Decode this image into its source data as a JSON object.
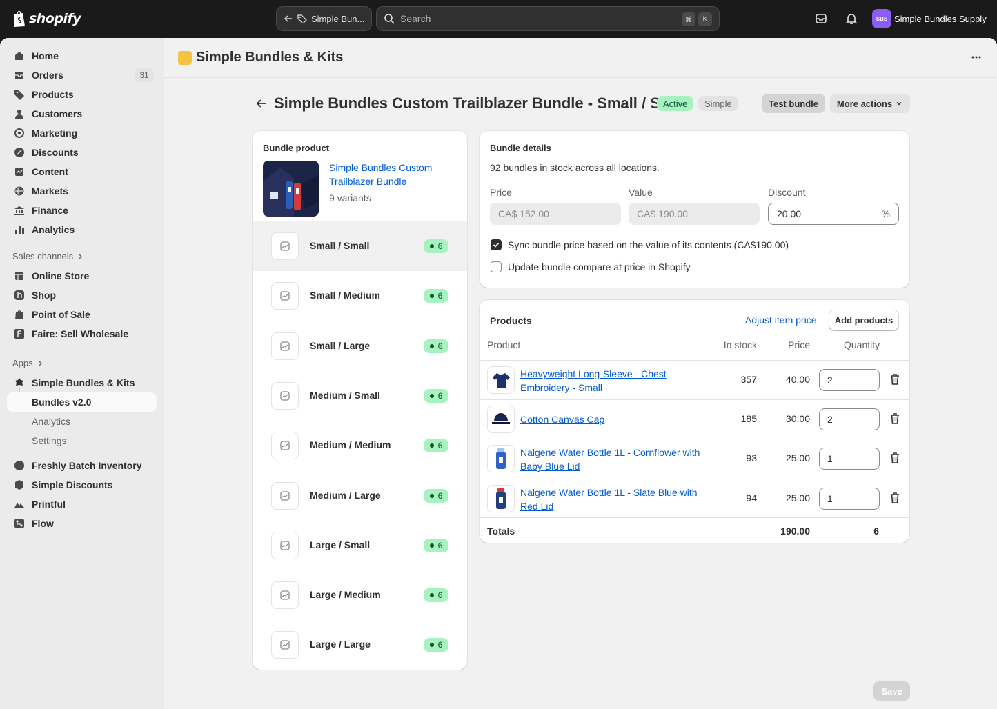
{
  "topbar": {
    "logo_text": "shopify",
    "back_label": "Simple Bun...",
    "search_placeholder": "Search",
    "kbd_cmd": "⌘",
    "kbd_k": "K",
    "store_initials": "SBS",
    "store_name": "Simple Bundles Supply"
  },
  "sidebar": {
    "items": [
      {
        "label": "Home",
        "icon": "home-icon"
      },
      {
        "label": "Orders",
        "icon": "orders-icon",
        "count": "31"
      },
      {
        "label": "Products",
        "icon": "tag-icon"
      },
      {
        "label": "Customers",
        "icon": "person-icon"
      },
      {
        "label": "Marketing",
        "icon": "target-icon"
      },
      {
        "label": "Discounts",
        "icon": "discount-icon"
      },
      {
        "label": "Content",
        "icon": "content-icon"
      },
      {
        "label": "Markets",
        "icon": "globe-icon"
      },
      {
        "label": "Finance",
        "icon": "bank-icon"
      },
      {
        "label": "Analytics",
        "icon": "chart-icon"
      }
    ],
    "sales_channels_label": "Sales channels",
    "channels": [
      {
        "label": "Online Store",
        "icon": "store-icon"
      },
      {
        "label": "Shop",
        "icon": "shop-icon"
      },
      {
        "label": "Point of Sale",
        "icon": "pos-icon"
      },
      {
        "label": "Faire: Sell Wholesale",
        "icon": "faire-icon"
      }
    ],
    "apps_label": "Apps",
    "apps": [
      {
        "label": "Simple Bundles & Kits",
        "icon": "app-icon"
      },
      {
        "label": "Bundles v2.0"
      },
      {
        "label": "Analytics"
      },
      {
        "label": "Settings"
      },
      {
        "label": "Freshly Batch Inventory",
        "icon": "app-icon"
      },
      {
        "label": "Simple Discounts",
        "icon": "app-icon"
      },
      {
        "label": "Printful",
        "icon": "printful-icon"
      },
      {
        "label": "Flow",
        "icon": "flow-icon"
      }
    ]
  },
  "app_header": {
    "title": "Simple Bundles & Kits"
  },
  "page": {
    "title": "Simple Bundles Custom Trailblazer Bundle - Small / Small",
    "status_active": "Active",
    "status_type": "Simple",
    "test_button": "Test bundle",
    "more_actions": "More actions",
    "save": "Save"
  },
  "bundle_product": {
    "heading": "Bundle product",
    "name": "Simple Bundles Custom Trailblazer Bundle",
    "variants_count": "9 variants",
    "variants": [
      {
        "label": "Small / Small",
        "count": "6",
        "selected": true
      },
      {
        "label": "Small / Medium",
        "count": "6"
      },
      {
        "label": "Small / Large",
        "count": "6"
      },
      {
        "label": "Medium / Small",
        "count": "6"
      },
      {
        "label": "Medium / Medium",
        "count": "6"
      },
      {
        "label": "Medium / Large",
        "count": "6"
      },
      {
        "label": "Large / Small",
        "count": "6"
      },
      {
        "label": "Large / Medium",
        "count": "6"
      },
      {
        "label": "Large / Large",
        "count": "6"
      }
    ]
  },
  "bundle_details": {
    "heading": "Bundle details",
    "stock_text": "92 bundles in stock across all locations.",
    "price_label": "Price",
    "price_value": "CA$  152.00",
    "value_label": "Value",
    "value_value": "CA$  190.00",
    "discount_label": "Discount",
    "discount_value": "20.00",
    "discount_suffix": "%",
    "sync_label": "Sync bundle price based on the value of its contents (CA$190.00)",
    "sync_checked": true,
    "compare_label": "Update bundle compare at price in Shopify",
    "compare_checked": false
  },
  "products": {
    "heading": "Products",
    "adjust_link": "Adjust item price",
    "add_button": "Add products",
    "columns": [
      "Product",
      "In stock",
      "Price",
      "Quantity"
    ],
    "rows": [
      {
        "name": "Heavyweight Long-Sleeve - Chest Embroidery - Small",
        "stock": "357",
        "price": "40.00",
        "qty": "2",
        "thumb": "shirt"
      },
      {
        "name": "Cotton Canvas Cap",
        "stock": "185",
        "price": "30.00",
        "qty": "2",
        "thumb": "cap"
      },
      {
        "name": "Nalgene Water Bottle 1L - Cornflower with Baby Blue Lid",
        "stock": "93",
        "price": "25.00",
        "qty": "1",
        "thumb": "bottle"
      },
      {
        "name": "Nalgene Water Bottle 1L - Slate Blue with Red Lid",
        "stock": "94",
        "price": "25.00",
        "qty": "1",
        "thumb": "bottle-red"
      }
    ],
    "totals_label": "Totals",
    "totals_price": "190.00",
    "totals_qty": "6"
  }
}
